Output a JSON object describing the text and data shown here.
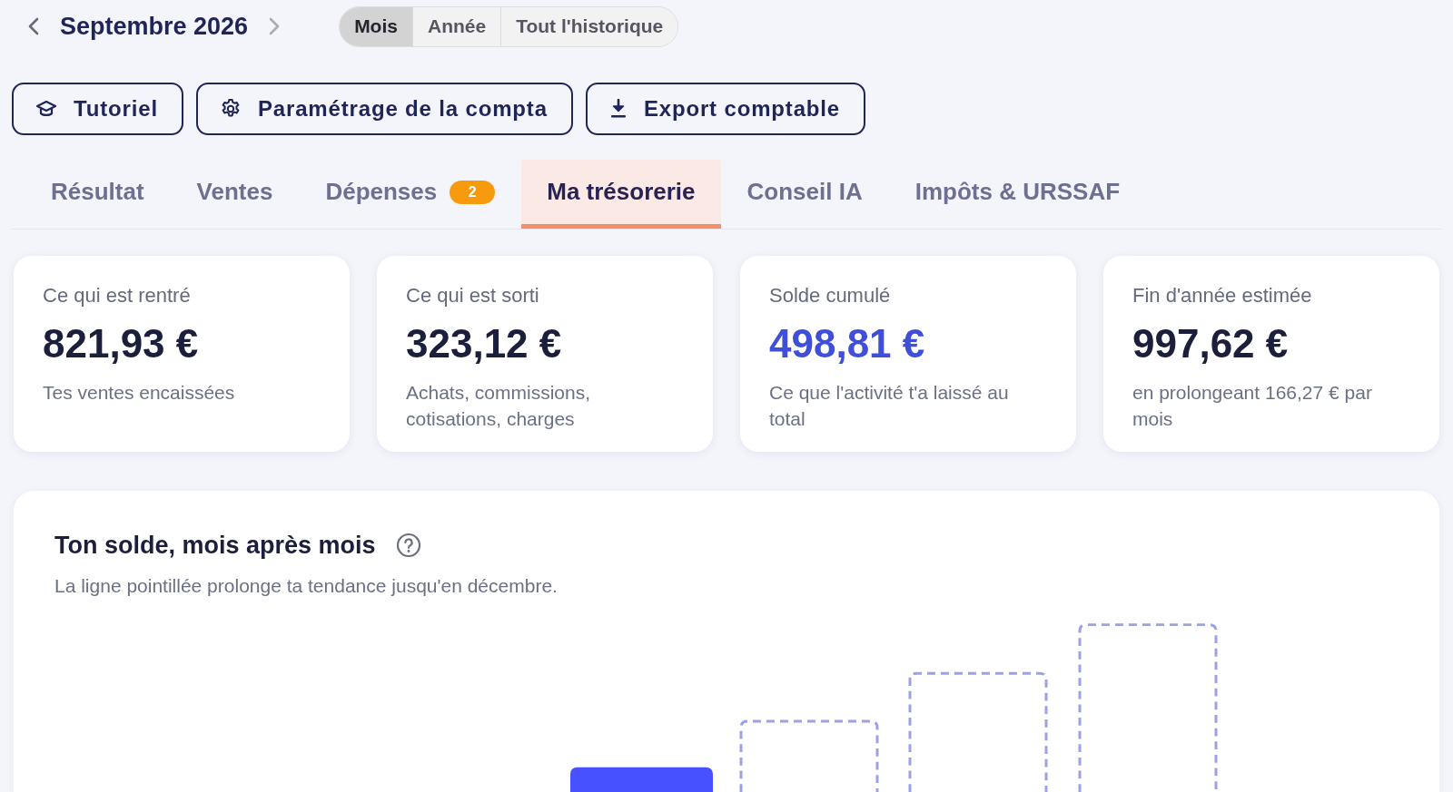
{
  "period_nav": {
    "title": "Septembre 2026"
  },
  "period_tabs": [
    {
      "label": "Mois",
      "selected": true
    },
    {
      "label": "Année",
      "selected": false
    },
    {
      "label": "Tout l'historique",
      "selected": false
    }
  ],
  "actions": [
    {
      "label": "Tutoriel",
      "kind": "tutorial"
    },
    {
      "label": "Paramétrage de la compta",
      "kind": "settings"
    },
    {
      "label": "Export comptable",
      "kind": "export"
    }
  ],
  "tabs": [
    {
      "label": "Résultat",
      "selected": false
    },
    {
      "label": "Ventes",
      "selected": false
    },
    {
      "label": "Dépenses",
      "selected": false,
      "badge": "2"
    },
    {
      "label": "Ma trésorerie",
      "selected": true
    },
    {
      "label": "Conseil IA",
      "selected": false
    },
    {
      "label": "Impôts & URSSAF",
      "selected": false
    }
  ],
  "cards": [
    {
      "label": "Ce qui est rentré",
      "value": "821,93 €",
      "note": "Tes ventes encaissées",
      "highlighted": false
    },
    {
      "label": "Ce qui est sorti",
      "value": "323,12 €",
      "note": "Achats, commissions, cotisations, charges",
      "highlighted": false
    },
    {
      "label": "Solde cumulé",
      "value": "498,81 €",
      "note": "Ce que l'activité t'a laissé au total",
      "highlighted": true
    },
    {
      "label": "Fin d'année estimée",
      "value": "997,62 €",
      "note": "en prolongeant 166,27 € par mois",
      "highlighted": false
    }
  ],
  "chart_panel": {
    "title": "Ton solde, mois après mois",
    "subtitle": "La ligne pointillée prolonge ta tendance jusqu'en décembre."
  }
}
